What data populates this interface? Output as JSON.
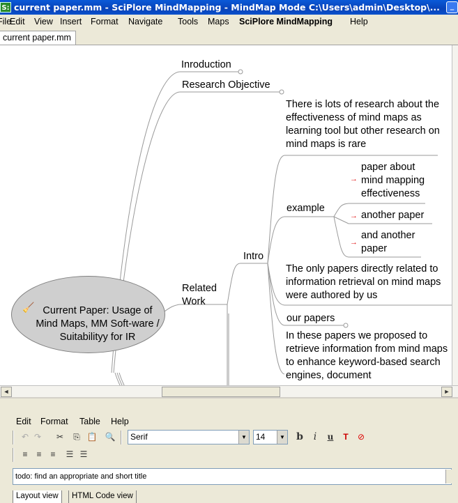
{
  "window": {
    "title": "current paper.mm - SciPlore MindMapping - MindMap Mode C:\\Users\\admin\\Desktop\\...",
    "app_icon_text": "S:",
    "minimize_glyph": "_"
  },
  "menubar": {
    "items": [
      "File",
      "Edit",
      "View",
      "Insert",
      "Format",
      "Navigate",
      "Tools",
      "Maps",
      "SciPlore MindMapping",
      "Help"
    ]
  },
  "tabs": {
    "file_tab": "current paper.mm"
  },
  "mindmap": {
    "root": "Current Paper: Usage of Mind Maps, MM Soft-ware / Suitabilityy for IR",
    "nodes": {
      "introduction": "Inroduction",
      "research_objective": "Research Objective",
      "related_work": "Related Work",
      "intro": "Intro",
      "research_text": "There is lots of research about the effectiveness of mind maps as learning tool but other research on mind maps is rare",
      "example": "example",
      "paper_about": "paper about mind mapping effectiveness",
      "another_paper": "another paper",
      "and_another": "and another paper",
      "only_papers": "The only papers directly related to information retrieval on mind maps were authored by us",
      "our_papers": "our papers",
      "these_papers": "In these papers we proposed to retrieve information from mind maps to enhance keyword-based search engines, document"
    },
    "link_arrow": "→",
    "root_icon": "broom-icon"
  },
  "scroll": {
    "left_arrow": "◄",
    "right_arrow": "►"
  },
  "editor": {
    "menu": [
      "Edit",
      "Format",
      "Table",
      "Help"
    ],
    "font_family": "Serif",
    "font_size": "14",
    "dropdown_arrow": "▼",
    "note_text": "todo: find an appropriate and short title",
    "tabs": [
      "Layout view",
      "HTML Code view"
    ],
    "toolbar_glyphs": {
      "undo": "↶",
      "redo": "↷",
      "cut": "✂",
      "copy": "⎘",
      "paste": "📋",
      "find": "🔍",
      "bold": "b",
      "italic": "i",
      "underline": "u",
      "color": "T",
      "clear": "⊘",
      "align_left": "≡",
      "align_center": "≡",
      "align_right": "≡",
      "bullets": "☰",
      "numbered": "☰"
    }
  }
}
